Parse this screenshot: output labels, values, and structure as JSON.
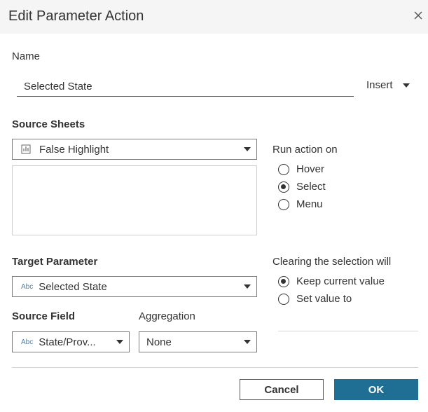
{
  "dialog": {
    "title": "Edit Parameter Action"
  },
  "name": {
    "label": "Name",
    "value": "Selected State",
    "insert_label": "Insert"
  },
  "source_sheets": {
    "label": "Source Sheets",
    "selected": "False Highlight",
    "icon": "bar-chart-icon"
  },
  "run_action_on": {
    "label": "Run action on",
    "options": [
      "Hover",
      "Select",
      "Menu"
    ],
    "selected": "Select"
  },
  "target_parameter": {
    "label": "Target Parameter",
    "type_tag": "Abc",
    "selected": "Selected State"
  },
  "clearing": {
    "label": "Clearing the selection will",
    "options": [
      "Keep current value",
      "Set value to"
    ],
    "selected": "Keep current value"
  },
  "source_field": {
    "label": "Source Field",
    "type_tag": "Abc",
    "selected": "State/Prov..."
  },
  "aggregation": {
    "label": "Aggregation",
    "selected": "None"
  },
  "buttons": {
    "cancel": "Cancel",
    "ok": "OK"
  },
  "colors": {
    "accent": "#1f6f95",
    "abc_tag": "#4f7fa8"
  }
}
